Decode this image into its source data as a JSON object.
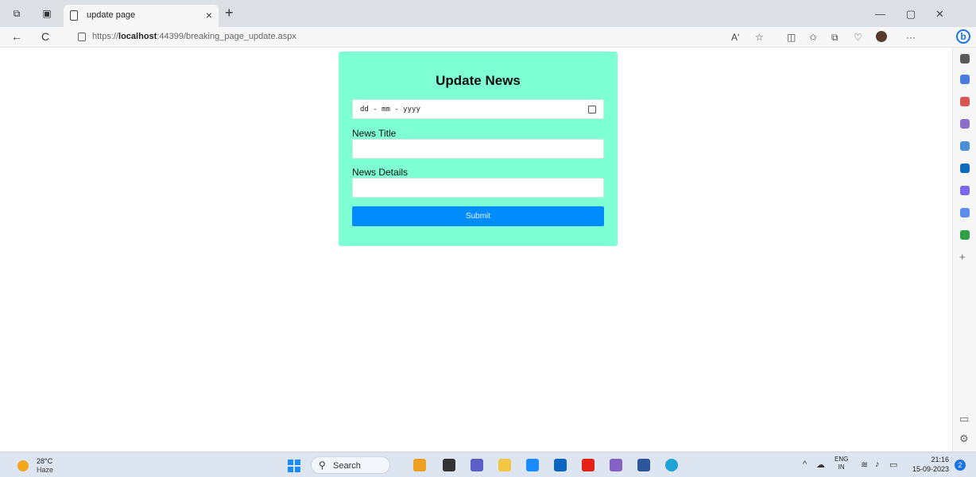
{
  "browser": {
    "tab_title": "update page",
    "tab_close": "×",
    "new_tab": "+",
    "url_prefix": "https://",
    "url_host": "localhost",
    "url_rest": ":44399/breaking_page_update.aspx",
    "nav": {
      "back": "←",
      "refresh": "C"
    },
    "window_controls": {
      "minimize": "—",
      "restore": "▢",
      "close": "✕"
    },
    "toolbar_icons": [
      "read-aloud-icon",
      "favorite-star-icon",
      "split-screen-icon",
      "favorites-icon",
      "collections-icon",
      "browser-essentials-icon",
      "profile-avatar-icon",
      "more-menu-icon",
      "bing-copilot-icon"
    ],
    "toolbar_glyphs": {
      "read_aloud": "Aʹ",
      "favorite": "☆",
      "split": "◫",
      "favorites": "✩",
      "collections": "⧉",
      "essentials": "♡",
      "more": "···",
      "bing": "b"
    }
  },
  "sidebar": {
    "icons": [
      "search-icon",
      "tag-icon",
      "shopping-icon",
      "people-icon",
      "office-icon",
      "outlook-icon",
      "designer-icon",
      "drop-icon",
      "tree-icon"
    ],
    "colors": [
      "#5a5a5a",
      "#4a7be0",
      "#d9534f",
      "#8b6fc9",
      "#4a90d9",
      "#0f6cbd",
      "#7b68ee",
      "#5b8def",
      "#2e9e44"
    ],
    "add": "+",
    "bottom_glyphs": {
      "panel": "▭",
      "settings": "⚙"
    }
  },
  "page": {
    "heading": "Update News",
    "date_placeholder": "dd - mm - yyyy",
    "title_label": "News Title",
    "title_value": "",
    "details_label": "News Details",
    "details_value": "",
    "submit_label": "Submit",
    "card_color": "#7fffd4",
    "button_color": "#008cff"
  },
  "taskbar": {
    "weather_temp": "28°C",
    "weather_cond": "Haze",
    "search_label": "Search",
    "search_glyph": "⚲",
    "pinned_apps": [
      "widget-app-icon",
      "file-manager-icon",
      "chat-icon",
      "folder-icon",
      "outlook-app-icon",
      "linkedin-app-icon",
      "youtube-app-icon",
      "visual-studio-icon",
      "word-app-icon",
      "edge-app-icon"
    ],
    "pinned_colors": [
      "#f0a020",
      "#333333",
      "#5b5fc7",
      "#f2c744",
      "#1a8cff",
      "#0a66c2",
      "#e62117",
      "#8661c5",
      "#2b579a",
      "#1fa2d4"
    ],
    "tray_glyphs": {
      "chevron": "^",
      "cloud": "☁",
      "wifi": "≋",
      "volume": "♪",
      "battery": "▭"
    },
    "lang_line1": "ENG",
    "lang_line2": "IN",
    "time": "21:16",
    "date": "15-09-2023",
    "notification_count": "2"
  }
}
